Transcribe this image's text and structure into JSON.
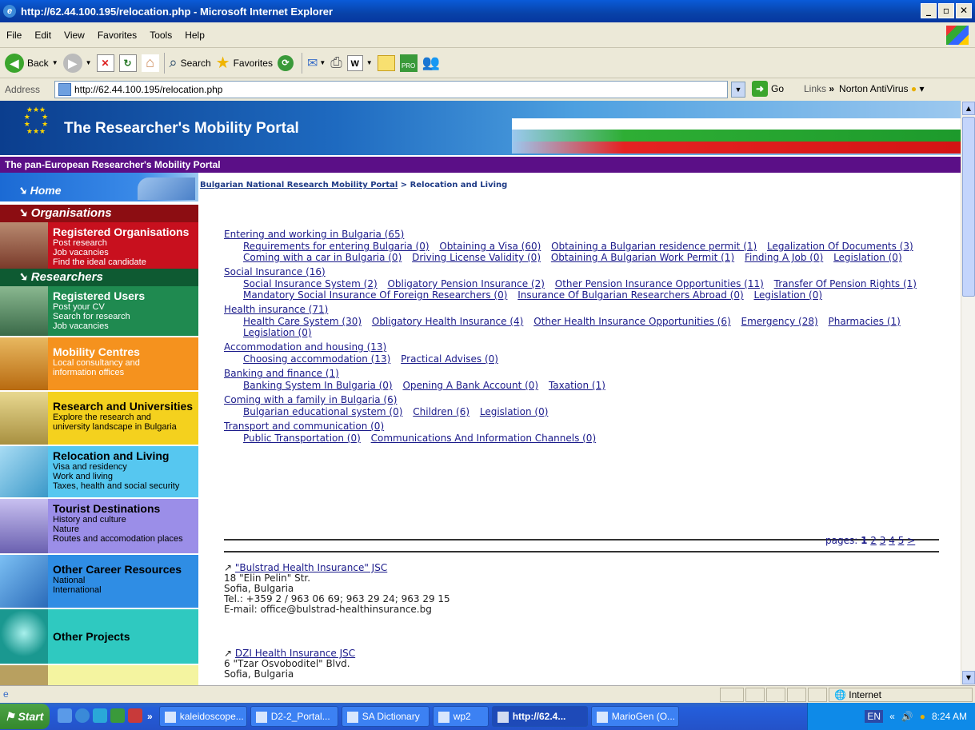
{
  "window": {
    "title": "http://62.44.100.195/relocation.php - Microsoft Internet Explorer"
  },
  "menu": [
    "File",
    "Edit",
    "View",
    "Favorites",
    "Tools",
    "Help"
  ],
  "toolbar": {
    "back": "Back",
    "search": "Search",
    "favorites": "Favorites"
  },
  "address": {
    "label": "Address",
    "url": "http://62.44.100.195/relocation.php",
    "go": "Go",
    "links": "Links",
    "norton": "Norton AntiVirus"
  },
  "banner": {
    "title": "The Researcher's Mobility Portal",
    "subtitle": "The pan-European Researcher's Mobility Portal"
  },
  "breadcrumb": {
    "link": "Bulgarian National Research Mobility Portal",
    "sep": " > ",
    "current": "Relocation and Living"
  },
  "sidebar": {
    "home": "Home",
    "organisations": "Organisations",
    "reg_org": {
      "title": "Registered Organisations",
      "lines": [
        "Post research",
        "Job vacancies",
        "Find the ideal candidate"
      ]
    },
    "researchers": "Researchers",
    "reg_users": {
      "title": "Registered Users",
      "lines": [
        "Post your CV",
        "Search for research",
        "Job vacancies"
      ]
    },
    "mobility": {
      "title": "Mobility Centres",
      "lines": [
        "Local consultancy and",
        "information offices"
      ]
    },
    "research": {
      "title": "Research and Universities",
      "lines": [
        "Explore the research and",
        "university landscape in Bulgaria"
      ]
    },
    "relocation": {
      "title": "Relocation and Living",
      "lines": [
        "Visa and residency",
        "Work and living",
        "Taxes, health and social security"
      ]
    },
    "tourist": {
      "title": "Tourist Destinations",
      "lines": [
        "History and culture",
        "Nature",
        "Routes and accomodation places"
      ]
    },
    "career": {
      "title": "Other Career Resources",
      "lines": [
        "National",
        "International"
      ]
    },
    "projects": {
      "title": "Other Projects"
    }
  },
  "categories": [
    {
      "title": "Entering and working in Bulgaria (65)",
      "items": [
        "Requirements for entering Bulgaria (0)",
        "Obtaining a Visa (60)",
        "Obtaining a Bulgarian residence permit (1)",
        "Legalization Of Documents (3)",
        "Coming with a car in Bulgaria (0)",
        "Driving License Validity (0)",
        "Obtaining A Bulgarian Work Permit (1)",
        "Finding A Job (0)",
        "Legislation (0)"
      ]
    },
    {
      "title": "Social Insurance (16)",
      "items": [
        "Social Insurance System (2)",
        "Obligatory Pension Insurance (2)",
        "Other Pension Insurance Opportunities (11)",
        "Transfer Of Pension Rights (1)",
        "Mandatory Social Insurance Of Foreign Researchers (0)",
        "Insurance Of Bulgarian Researchers Abroad (0)",
        "Legislation (0)"
      ]
    },
    {
      "title": "Health insurance (71)",
      "items": [
        "Health Care System (30)",
        "Obligatory Health Insurance (4)",
        "Other Health Insurance Opportunities (6)",
        "Emergency (28)",
        "Pharmacies (1)",
        "Legislation (0)"
      ]
    },
    {
      "title": "Accommodation and housing (13)",
      "items": [
        "Choosing accommodation (13)",
        "Practical Advises (0)"
      ]
    },
    {
      "title": "Banking and finance (1)",
      "items": [
        "Banking System In Bulgaria (0)",
        "Opening A Bank Account (0)",
        "Taxation (1)"
      ]
    },
    {
      "title": "Coming with a family in Bulgaria (6)",
      "items": [
        "Bulgarian educational system (0)",
        "Children (6)",
        "Legislation (0)"
      ]
    },
    {
      "title": "Transport and communication (0)",
      "items": [
        "Public Transportation (0)",
        "Communications And Information Channels (0)"
      ]
    }
  ],
  "pager": {
    "label": "pages:",
    "current": "1",
    "others": [
      "2",
      "3",
      "4",
      "5"
    ],
    "next": ">"
  },
  "entries": [
    {
      "title": "\"Bulstrad Health Insurance\" JSC",
      "lines": [
        "18 \"Elin Pelin\" Str.",
        "Sofia, Bulgaria",
        "Tel.: +359 2 / 963 06 69; 963 29 24; 963 29 15",
        "E-mail: office@bulstrad-healthinsurance.bg"
      ]
    },
    {
      "title": "DZI Health Insurance JSC",
      "lines": [
        "6 \"Tzar Osvoboditel\" Blvd.",
        "Sofia, Bulgaria"
      ]
    }
  ],
  "status": {
    "zone": "Internet"
  },
  "taskbar": {
    "start": "Start",
    "tasks": [
      "kaleidoscope...",
      "D2-2_Portal...",
      "SA Dictionary",
      "wp2",
      "http://62.4...",
      "MarioGen (O..."
    ],
    "active_index": 4,
    "lang": "EN",
    "time": "8:24 AM"
  },
  "colors": {
    "purple_bar": "#5b0f87",
    "link": "#1a1a8a",
    "org_red": "#c8101e",
    "researchers_green": "#1f8a50",
    "mobility_orange": "#f5921e",
    "research_yellow": "#f4d11e",
    "relocation_cyan": "#56c7f0",
    "tourist_purple": "#9b8ee8",
    "career_blue": "#2f8de4",
    "projects_teal": "#2fc9c0"
  }
}
